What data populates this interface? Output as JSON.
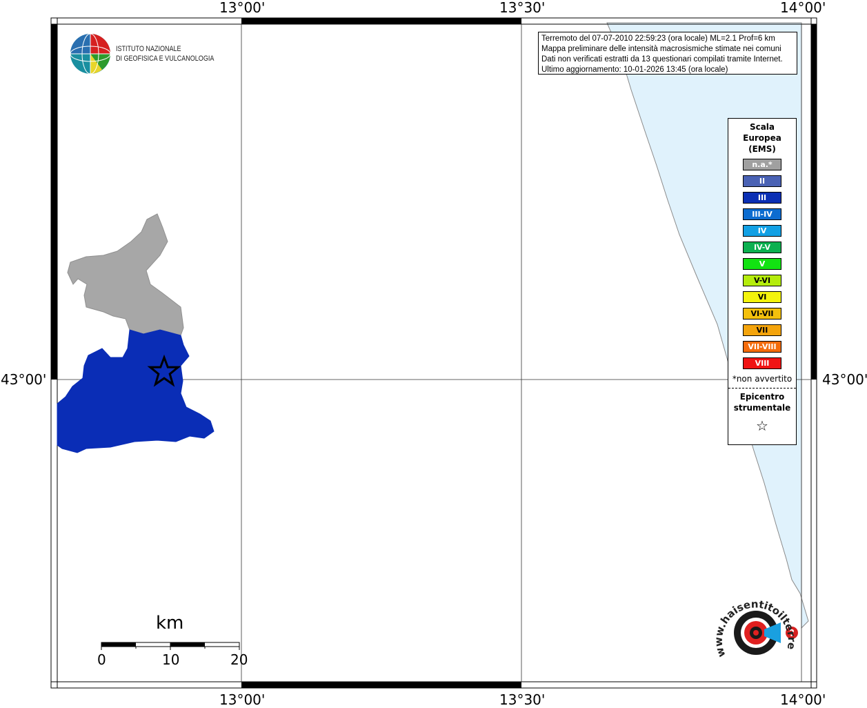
{
  "axes": {
    "top_labels": [
      "13°00'",
      "13°30'",
      "14°00'"
    ],
    "bottom_labels": [
      "13°00'",
      "13°30'",
      "14°00'"
    ],
    "left_label": "43°00'",
    "right_label": "43°00'"
  },
  "logo": {
    "line1": "ISTITUTO NAZIONALE",
    "line2": "DI GEOFISICA E VULCANOLOGIA"
  },
  "info": {
    "line1": "Terremoto del 07-07-2010 22:59:23 (ora locale) ML=2.1 Prof=6 km",
    "line2": "Mappa preliminare delle intensità macrosismiche stimate nei comuni",
    "line3": "Dati non verificati estratti da 13 questionari compilati tramite Internet.",
    "line4": "Ultimo aggiornamento: 10-01-2026 13:45 (ora locale)"
  },
  "legend": {
    "title_line1": "Scala",
    "title_line2": "Europea",
    "title_line3": "(EMS)",
    "items": [
      {
        "label": "n.a.*",
        "color": "#a0a0a0"
      },
      {
        "label": "II",
        "color": "#4a62b4"
      },
      {
        "label": "III",
        "color": "#0b2fb4"
      },
      {
        "label": "III-IV",
        "color": "#0c6cd0"
      },
      {
        "label": "IV",
        "color": "#12a0e4"
      },
      {
        "label": "IV-V",
        "color": "#0cb050"
      },
      {
        "label": "V",
        "color": "#12e212"
      },
      {
        "label": "V-VI",
        "color": "#b4ec0c"
      },
      {
        "label": "VI",
        "color": "#f4f40c"
      },
      {
        "label": "VI-VII",
        "color": "#f4c00c"
      },
      {
        "label": "VII",
        "color": "#f4a40c"
      },
      {
        "label": "VII-VIII",
        "color": "#f46c0c"
      },
      {
        "label": "VIII",
        "color": "#f01414"
      }
    ],
    "note": "*non avvertito",
    "epicenter_line1": "Epicentro",
    "epicenter_line2": "strumentale",
    "epicenter_symbol": "☆"
  },
  "scalebar": {
    "unit": "km",
    "ticks": [
      "0",
      "10",
      "20"
    ]
  },
  "watermark": {
    "text": "www.haisentitoilterremoto.it",
    "symbol": "?"
  },
  "colors": {
    "sea": "#e0f2fc",
    "not_felt": "#a7a7a7",
    "intensity_III": "#0a2db6",
    "frame": "#000000"
  }
}
